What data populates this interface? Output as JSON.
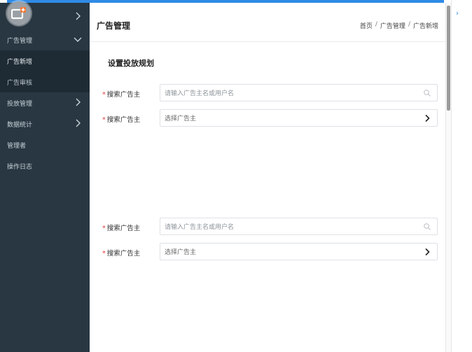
{
  "sidebar": {
    "items": [
      {
        "label": "",
        "has_chevron": true,
        "chevron": "chevron-right"
      },
      {
        "label": "广告管理",
        "has_chevron": true,
        "chevron": "chevron-down"
      },
      {
        "label": "广告新增",
        "sub": true
      },
      {
        "label": "广告审核",
        "sub": true
      },
      {
        "label": "投放管理",
        "has_chevron": true,
        "chevron": "chevron-right"
      },
      {
        "label": "数据统计",
        "has_chevron": true,
        "chevron": "chevron-right"
      },
      {
        "label": "管理者"
      },
      {
        "label": "操作日志"
      }
    ]
  },
  "header": {
    "title": "广告管理",
    "breadcrumb": [
      "首页",
      "广告管理",
      "广告新增"
    ],
    "separator": "/"
  },
  "form": {
    "section_title": "设置投放规划",
    "rows": [
      {
        "label": "搜索广告主",
        "required": true,
        "type": "search",
        "placeholder": "请输入广告主名或用户名"
      },
      {
        "label": "搜索广告主",
        "required": true,
        "type": "select",
        "placeholder": "选择广告主"
      },
      {
        "label": "搜索广告主",
        "required": true,
        "type": "search",
        "placeholder": "请输入广告主名或用户名"
      },
      {
        "label": "搜索广告主",
        "required": true,
        "type": "select",
        "placeholder": "选择广告主"
      }
    ]
  },
  "colors": {
    "sidebar_bg": "#283742",
    "submenu_bg": "#1f2b34",
    "accent": "#2f8be6",
    "required": "#e4393c"
  },
  "icons": {
    "logo": "app-logo-icon",
    "search": "search-icon",
    "select": "chevron-right-icon",
    "expand": "chevron-right-icon"
  },
  "right_pane": {
    "arrow": "›"
  }
}
